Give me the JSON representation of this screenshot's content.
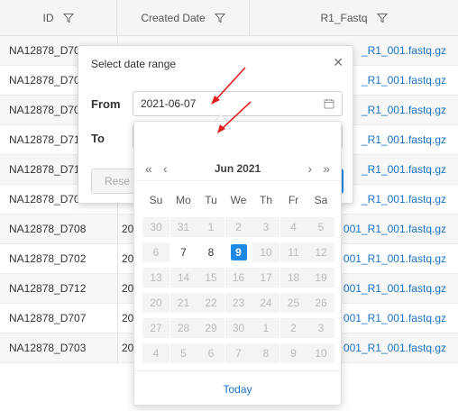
{
  "table": {
    "columns": [
      {
        "label": "ID",
        "icon": "filter-icon"
      },
      {
        "label": "Created Date",
        "icon": "filter-icon"
      },
      {
        "label": "R1_Fastq",
        "icon": "filter-icon"
      }
    ],
    "rows": [
      {
        "id": "NA12878_D70",
        "date": "",
        "r1": "_R1_001.fastq.gz"
      },
      {
        "id": "NA12878_D70",
        "date": "",
        "r1": "_R1_001.fastq.gz"
      },
      {
        "id": "NA12878_D70",
        "date": "",
        "r1": "_R1_001.fastq.gz"
      },
      {
        "id": "NA12878_D71",
        "date": "",
        "r1": "_R1_001.fastq.gz"
      },
      {
        "id": "NA12878_D71",
        "date": "",
        "r1": "_R1_001.fastq.gz"
      },
      {
        "id": "NA12878_D70",
        "date": "",
        "r1": "_R1_001.fastq.gz"
      },
      {
        "id": "NA12878_D708",
        "date": "20",
        "r1": "001_R1_001.fastq.gz"
      },
      {
        "id": "NA12878_D702",
        "date": "20",
        "r1": "001_R1_001.fastq.gz"
      },
      {
        "id": "NA12878_D712",
        "date": "20",
        "r1": "001_R1_001.fastq.gz"
      },
      {
        "id": "NA12878_D707",
        "date": "20",
        "r1": "001_R1_001.fastq.gz"
      },
      {
        "id": "NA12878_D703",
        "date": "20",
        "r1": "001_R1_001.fastq.gz"
      }
    ]
  },
  "panel": {
    "title": "Select date range",
    "close_icon": "close-icon",
    "from_label": "From",
    "from_value": "2021-06-07",
    "to_label": "To",
    "to_value": "",
    "reset_label": "Rese"
  },
  "calendar": {
    "month_label": "Jun 2021",
    "prev_year": "«",
    "prev_month": "‹",
    "next_month": "›",
    "next_year": "»",
    "weekdays": [
      "Su",
      "Mo",
      "Tu",
      "We",
      "Th",
      "Fr",
      "Sa"
    ],
    "weeks": [
      [
        {
          "d": "30",
          "s": "out"
        },
        {
          "d": "31",
          "s": "out"
        },
        {
          "d": "1",
          "s": "dis"
        },
        {
          "d": "2",
          "s": "dis"
        },
        {
          "d": "3",
          "s": "dis"
        },
        {
          "d": "4",
          "s": "dis"
        },
        {
          "d": "5",
          "s": "dis"
        }
      ],
      [
        {
          "d": "6",
          "s": "dis"
        },
        {
          "d": "7",
          "s": "in"
        },
        {
          "d": "8",
          "s": "in"
        },
        {
          "d": "9",
          "s": "sel"
        },
        {
          "d": "10",
          "s": "dis"
        },
        {
          "d": "11",
          "s": "dis"
        },
        {
          "d": "12",
          "s": "dis"
        }
      ],
      [
        {
          "d": "13",
          "s": "dis"
        },
        {
          "d": "14",
          "s": "dis"
        },
        {
          "d": "15",
          "s": "dis"
        },
        {
          "d": "16",
          "s": "dis"
        },
        {
          "d": "17",
          "s": "dis"
        },
        {
          "d": "18",
          "s": "dis"
        },
        {
          "d": "19",
          "s": "dis"
        }
      ],
      [
        {
          "d": "20",
          "s": "dis"
        },
        {
          "d": "21",
          "s": "dis"
        },
        {
          "d": "22",
          "s": "dis"
        },
        {
          "d": "23",
          "s": "dis"
        },
        {
          "d": "24",
          "s": "dis"
        },
        {
          "d": "25",
          "s": "dis"
        },
        {
          "d": "26",
          "s": "dis"
        }
      ],
      [
        {
          "d": "27",
          "s": "dis"
        },
        {
          "d": "28",
          "s": "dis"
        },
        {
          "d": "29",
          "s": "dis"
        },
        {
          "d": "30",
          "s": "dis"
        },
        {
          "d": "1",
          "s": "out"
        },
        {
          "d": "2",
          "s": "out"
        },
        {
          "d": "3",
          "s": "out"
        }
      ],
      [
        {
          "d": "4",
          "s": "out"
        },
        {
          "d": "5",
          "s": "out"
        },
        {
          "d": "6",
          "s": "out"
        },
        {
          "d": "7",
          "s": "out"
        },
        {
          "d": "8",
          "s": "out"
        },
        {
          "d": "9",
          "s": "out"
        },
        {
          "d": "10",
          "s": "out"
        }
      ]
    ],
    "today_label": "Today"
  },
  "colors": {
    "accent": "#1e88e5",
    "link": "#1a73c8",
    "annotation": "#e02020"
  }
}
